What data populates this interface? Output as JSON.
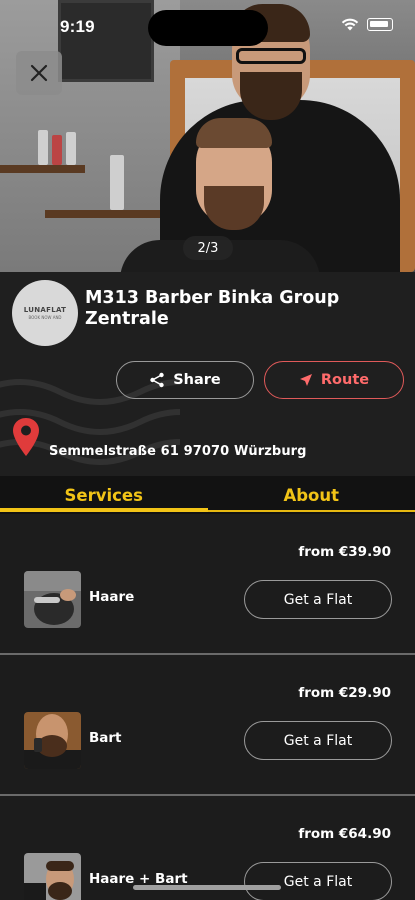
{
  "status_bar": {
    "time": "9:19"
  },
  "hero": {
    "pager": "2/3"
  },
  "shop": {
    "logo_text": "LUNAFLAT",
    "logo_sub": "BOOK NOW AND",
    "name": "M313 Barber Binka Group Zentrale",
    "address": "Semmelstraße 61 97070 Würzburg"
  },
  "actions": {
    "share_label": "Share",
    "route_label": "Route"
  },
  "tabs": [
    {
      "label": "Services",
      "active": true
    },
    {
      "label": "About",
      "active": false
    }
  ],
  "services": [
    {
      "name": "Haare",
      "price": "from €39.90",
      "button": "Get a Flat",
      "thumb_icon": "haircut-photo"
    },
    {
      "name": "Bart",
      "price": "from €29.90",
      "button": "Get a Flat",
      "thumb_icon": "beard-photo"
    },
    {
      "name": "Haare + Bart",
      "price": "from €64.90",
      "button": "Get a Flat",
      "thumb_icon": "hair-and-beard-photo"
    }
  ],
  "colors": {
    "accent": "#f2c417",
    "route": "#ff6b6b",
    "background": "#1f1f1f"
  }
}
